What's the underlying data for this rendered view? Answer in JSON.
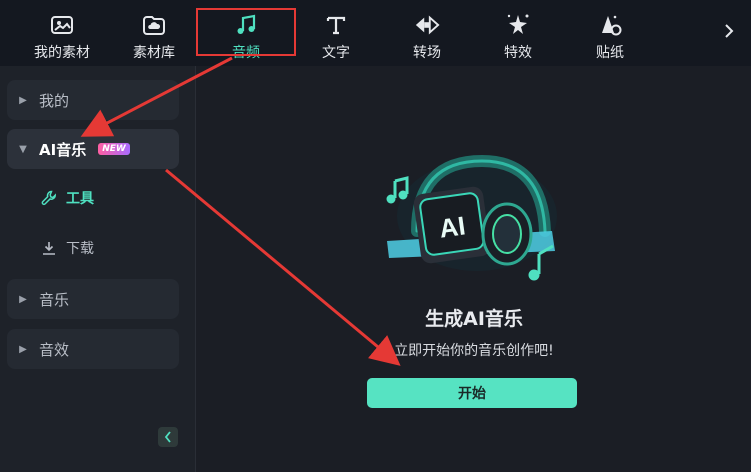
{
  "toolbar": {
    "items": [
      {
        "label": "我的素材",
        "icon": "image-folder-icon"
      },
      {
        "label": "素材库",
        "icon": "cloud-folder-icon"
      },
      {
        "label": "音频",
        "icon": "music-note-icon"
      },
      {
        "label": "文字",
        "icon": "text-icon"
      },
      {
        "label": "转场",
        "icon": "transition-icon"
      },
      {
        "label": "特效",
        "icon": "effects-icon"
      },
      {
        "label": "贴纸",
        "icon": "sticker-icon"
      }
    ],
    "active_index": 2,
    "more_icon": "chevron-right-icon"
  },
  "sidebar": {
    "items": [
      {
        "label": "我的",
        "expanded": false
      },
      {
        "label": "AI音乐",
        "expanded": true,
        "badge": "NEW"
      },
      {
        "label": "音乐",
        "expanded": false
      },
      {
        "label": "音效",
        "expanded": false
      }
    ],
    "sub_items": [
      {
        "label": "工具",
        "icon": "wrench-icon",
        "active": true
      },
      {
        "label": "下载",
        "icon": "download-icon",
        "active": false
      }
    ],
    "collapse_icon": "chevron-left-icon"
  },
  "main": {
    "illustration": "ai-headphones-icon",
    "title": "生成AI音乐",
    "subtitle": "立即开始你的音乐创作吧!",
    "start_label": "开始",
    "illustration_text": "AI"
  },
  "colors": {
    "accent": "#4fe0c0",
    "button": "#56e3c2",
    "annotation": "#e53935",
    "badge_from": "#ff5fa2",
    "badge_to": "#a86bff"
  }
}
